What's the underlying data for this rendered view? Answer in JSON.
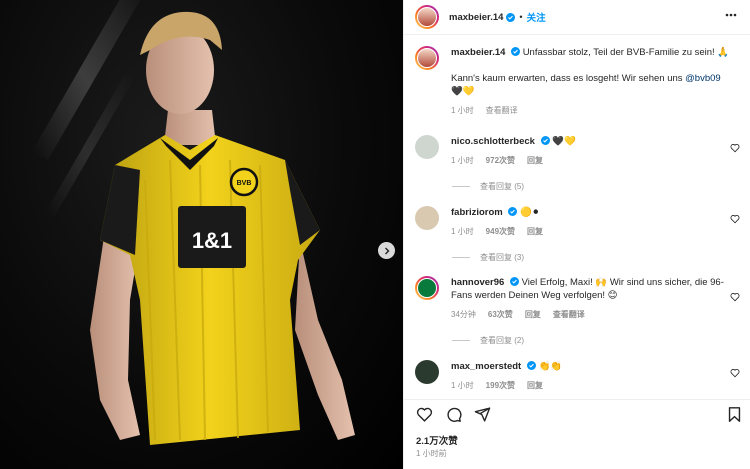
{
  "post": {
    "author": "maxbeier.14",
    "follow_label": "关注",
    "dot": "•",
    "caption_line1": "Unfassbar stolz, Teil der BVB-Familie zu sein! 🙏",
    "caption_line2_prefix": "Kann's kaum erwarten, dass es losgeht! Wir sehen uns ",
    "caption_mention": "@bvb09",
    "caption_emojis": "🖤💛",
    "caption_time": "1 小时",
    "caption_translate": "查看翻译",
    "likes": "2.1万次赞",
    "time": "1 小时前",
    "photo_sponsor": "1&1",
    "photo_badge": "BVB"
  },
  "comments": [
    {
      "user": "nico.schlotterbeck",
      "text": "🖤💛",
      "time": "1 小时",
      "likes": "972次赞",
      "reply": "回复",
      "translate": "",
      "view_replies": "查看回复 (5)"
    },
    {
      "user": "fabriziorom",
      "text": "🟡⚫",
      "time": "1 小时",
      "likes": "949次赞",
      "reply": "回复",
      "translate": "",
      "view_replies": "查看回复 (3)"
    },
    {
      "user": "hannover96",
      "text": "Viel Erfolg, Maxi! 🙌 Wir sind uns sicher, die 96-Fans werden Deinen Weg verfolgen! 😊",
      "time": "34分钟",
      "likes": "63次赞",
      "reply": "回复",
      "translate": "查看翻译",
      "view_replies": "查看回复 (2)"
    },
    {
      "user": "max_moerstedt",
      "text": "👏👏",
      "time": "1 小时",
      "likes": "199次赞",
      "reply": "回复",
      "translate": "",
      "view_replies": ""
    }
  ],
  "colors": {
    "verified": "#0095f6",
    "follow": "#0095f6",
    "kit_yellow": "#f2d21b",
    "kit_black": "#111111"
  },
  "icons": [
    "heart-icon",
    "comment-icon",
    "share-icon",
    "bookmark-icon",
    "more-icon",
    "verified-icon",
    "chevron-right-icon"
  ]
}
